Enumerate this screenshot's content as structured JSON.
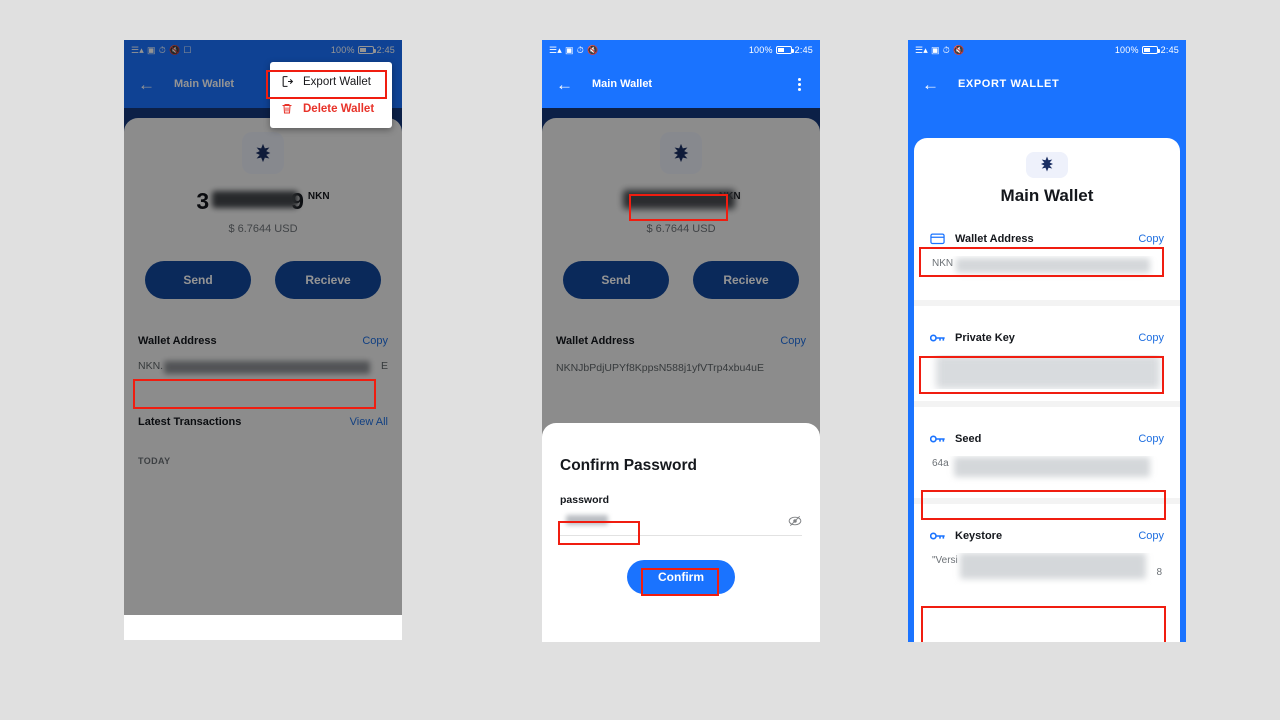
{
  "statusbar": {
    "signal_icons": [
      "signal-icon",
      "sim-icon",
      "alarm-icon",
      "mute-icon",
      "message-icon"
    ],
    "battery_percent": "100%",
    "time": "2:45"
  },
  "panel1": {
    "appbar": {
      "back_icon": "back-arrow-icon",
      "title": "Main Wallet"
    },
    "menu": {
      "items": [
        {
          "label": "Export Wallet",
          "icon": "export-icon"
        },
        {
          "label": "Delete Wallet",
          "icon": "trash-icon"
        }
      ]
    },
    "wallet": {
      "coin_icon": "nkn-logo-icon",
      "balance_prefix": "3",
      "balance_suffix": "9",
      "balance_unit": "NKN",
      "fiat": "$ 6.7644 USD",
      "send_label": "Send",
      "receive_label": "Recieve",
      "address_label": "Wallet Address",
      "copy_label": "Copy",
      "address_prefix": "NKN.",
      "address_suffix": "E",
      "transactions_label": "Latest Transactions",
      "view_all_label": "View All",
      "today_label": "TODAY"
    }
  },
  "panel2": {
    "appbar": {
      "back_icon": "back-arrow-icon",
      "title": "Main Wallet",
      "menu_icon": "kebab-menu-icon"
    },
    "wallet": {
      "coin_icon": "nkn-logo-icon",
      "balance_unit": "NKN",
      "fiat": "$ 6.7644 USD",
      "send_label": "Send",
      "receive_label": "Recieve",
      "address_label": "Wallet Address",
      "copy_label": "Copy",
      "address_value": "NKNJbPdjUPYf8KppsN588j1yfVTrp4xbu4uE"
    },
    "dialog": {
      "title": "Confirm Password",
      "field_label": "password",
      "field_value": "",
      "eye_icon": "eye-off-icon",
      "confirm_label": "Confirm"
    }
  },
  "panel3": {
    "appbar": {
      "back_icon": "back-arrow-icon",
      "title": "EXPORT WALLET"
    },
    "wallet_name": "Main Wallet",
    "badge_icon": "nkn-logo-icon",
    "copy_label": "Copy",
    "sections": [
      {
        "label": "Wallet Address",
        "icon": "wallet-icon",
        "prefix": "NKN",
        "suffix": ""
      },
      {
        "label": "Private Key",
        "icon": "key-icon",
        "prefix": "",
        "suffix": ""
      },
      {
        "label": "Seed",
        "icon": "key-icon",
        "prefix": "64a",
        "suffix": ""
      },
      {
        "label": "Keystore",
        "icon": "key-icon",
        "prefix": "\"Versi",
        "suffix": "8"
      }
    ]
  },
  "colors": {
    "brand_blue": "#1a73ff",
    "dark_blue": "#15387a",
    "button_blue": "#12479b",
    "link_blue": "#1f6fe0",
    "annotation_red": "#f01d10",
    "delete_red": "#e8332a",
    "background": "#e0e0e0"
  }
}
